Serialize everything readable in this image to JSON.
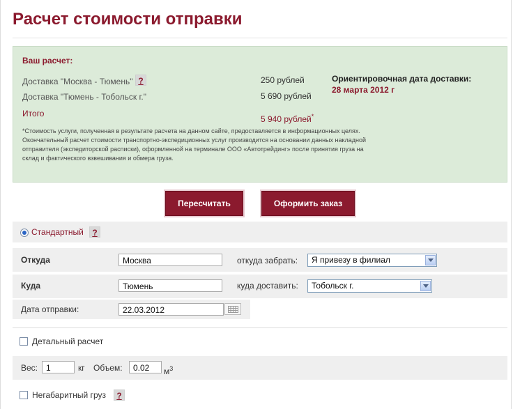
{
  "page": {
    "title": "Расчет стоимости отправки"
  },
  "result": {
    "title": "Ваш расчет:",
    "rows": [
      {
        "label": "Доставка \"Москва - Тюмень\"",
        "price": "250 рублей",
        "help": "?"
      },
      {
        "label": "Доставка \"Тюмень - Тобольск г.\"",
        "price": "5 690 рублей"
      }
    ],
    "total_label": "Итого",
    "total_price": "5 940 рублей",
    "total_mark": "*",
    "date_header": "Ориентировочная дата доставки:",
    "date_value": "28 марта 2012 г",
    "note": "*Стоимость услуги, полученная в результате расчета на данном сайте, предоставляется в информационных целях. Окончательный расчет стоимости транспортно-экспедиционных услуг производится на основании данных накладной отправителя (экспедиторской расписки), оформленной на терминале ООО «Автотрейдинг» после принятия груза на склад и фактического взвешивания и обмера груза."
  },
  "buttons": {
    "recalc": "Пересчитать",
    "order": "Оформить заказ"
  },
  "tariff": {
    "label": "Стандартный",
    "selected": true,
    "help": "?"
  },
  "from": {
    "label": "Откуда",
    "value": "Москва",
    "pickup_label": "откуда забрать:",
    "pickup_value": "Я привезу в филиал"
  },
  "to": {
    "label": "Куда",
    "value": "Тюмень",
    "delivery_label": "куда доставить:",
    "delivery_value": "Тобольск г."
  },
  "send_date": {
    "label": "Дата отправки:",
    "value": "22.03.2012"
  },
  "detailed": {
    "label": "Детальный расчет",
    "checked": false
  },
  "cargo": {
    "weight_label": "Вес:",
    "weight_value": "1",
    "weight_unit": "кг",
    "volume_label": "Объем:",
    "volume_value": "0.02",
    "volume_unit": "м",
    "volume_exp": "3"
  },
  "oversize": {
    "label": "Негабаритный груз",
    "checked": false,
    "help": "?"
  }
}
